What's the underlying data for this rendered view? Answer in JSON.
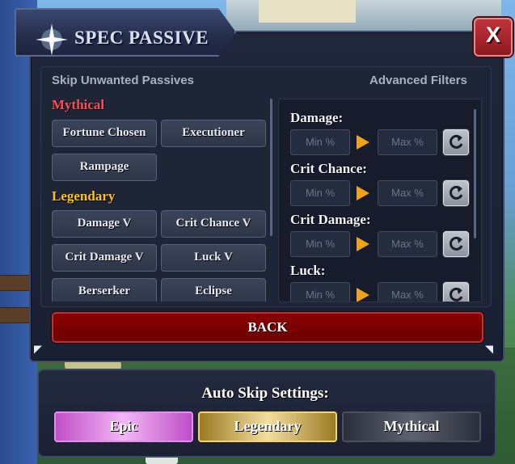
{
  "title": "SPEC PASSIVE",
  "close_label": "X",
  "left_header": "Skip Unwanted Passives",
  "right_header": "Advanced Filters",
  "categories": {
    "mythical": {
      "label": "Mythical",
      "passives": [
        "Fortune Chosen",
        "Executioner",
        "Rampage"
      ]
    },
    "legendary": {
      "label": "Legendary",
      "passives": [
        "Damage V",
        "Crit Chance V",
        "Crit Damage V",
        "Luck V",
        "Berserker",
        "Eclipse"
      ]
    }
  },
  "filters": [
    {
      "label": "Damage:",
      "min_placeholder": "Min %",
      "max_placeholder": "Max %"
    },
    {
      "label": "Crit Chance:",
      "min_placeholder": "Min %",
      "max_placeholder": "Max %"
    },
    {
      "label": "Crit Damage:",
      "min_placeholder": "Min %",
      "max_placeholder": "Max %"
    },
    {
      "label": "Luck:",
      "min_placeholder": "Min %",
      "max_placeholder": "Max %"
    }
  ],
  "back_label": "BACK",
  "auto_skip": {
    "title": "Auto Skip Settings:",
    "options": [
      "Epic",
      "Legendary",
      "Mythical"
    ]
  },
  "colors": {
    "mythical": "#ff4b5a",
    "legendary": "#ffc21a",
    "arrow": "#f0a21a",
    "back": "#7a0000"
  }
}
